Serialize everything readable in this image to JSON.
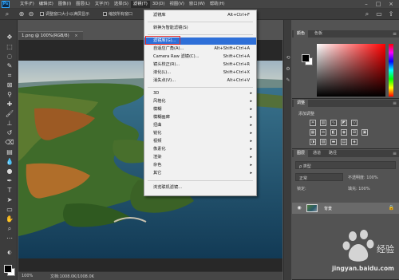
{
  "menubar": {
    "logo": "Ps",
    "items": [
      "文件(F)",
      "编辑(E)",
      "图像(I)",
      "图层(L)",
      "文字(Y)",
      "选择(S)",
      "滤镜(T)",
      "3D(D)",
      "视图(V)",
      "窗口(W)",
      "帮助(H)"
    ],
    "active_index": 6,
    "minimize": "–",
    "maximize": "□",
    "close": "×"
  },
  "options_bar": {
    "check1_label": "调整窗口大小以满屏显示",
    "check2_label": "缩放所有窗口"
  },
  "document": {
    "tab_title": "1.png @ 100%(RGB/8)",
    "tab_close": "×",
    "zoom": "100%",
    "doc_info": "文档:1008.0K/1008.0K"
  },
  "filter_menu": {
    "items": [
      {
        "label": "滤镜库",
        "shortcut": "Alt+Ctrl+F"
      },
      {
        "label": "转换为智能滤镜(S)",
        "shortcut": ""
      },
      {
        "label": "滤镜库(G)...",
        "shortcut": ""
      },
      {
        "label": "自适应广角(A)...",
        "shortcut": "Alt+Shift+Ctrl+A"
      },
      {
        "label": "Camera Raw 滤镜(C)...",
        "shortcut": "Shift+Ctrl+A"
      },
      {
        "label": "镜头校正(R)...",
        "shortcut": "Shift+Ctrl+R"
      },
      {
        "label": "液化(L)...",
        "shortcut": "Shift+Ctrl+X"
      },
      {
        "label": "消失点(V)...",
        "shortcut": "Alt+Ctrl+V"
      },
      {
        "label": "3D",
        "shortcut": ""
      },
      {
        "label": "风格化",
        "shortcut": ""
      },
      {
        "label": "模糊",
        "shortcut": ""
      },
      {
        "label": "模糊画廊",
        "shortcut": ""
      },
      {
        "label": "扭曲",
        "shortcut": ""
      },
      {
        "label": "锐化",
        "shortcut": ""
      },
      {
        "label": "视频",
        "shortcut": ""
      },
      {
        "label": "像素化",
        "shortcut": ""
      },
      {
        "label": "渲染",
        "shortcut": ""
      },
      {
        "label": "杂色",
        "shortcut": ""
      },
      {
        "label": "其它",
        "shortcut": ""
      },
      {
        "label": "浏览联机滤镜...",
        "shortcut": ""
      }
    ],
    "submenu_arrow": "▸"
  },
  "color_panel": {
    "tabs": [
      "颜色",
      "色板"
    ],
    "menu_icon": "≡"
  },
  "adjust_panel": {
    "tabs": [
      "调整"
    ],
    "subtitle": "添加调整"
  },
  "layers_panel": {
    "tabs": [
      "图层",
      "通道",
      "路径"
    ],
    "kind_filter": "ρ 类型",
    "blend_mode": "正常",
    "opacity_label": "不透明度: 100%",
    "lock_label": "锁定:",
    "fill_label": "填充: 100%",
    "layer_name": "背景"
  },
  "watermark": {
    "site": "jingyan.baidu.com"
  },
  "colors": {
    "menu_highlight": "#2e6fd8",
    "annotation_red": "#e22a2a"
  }
}
